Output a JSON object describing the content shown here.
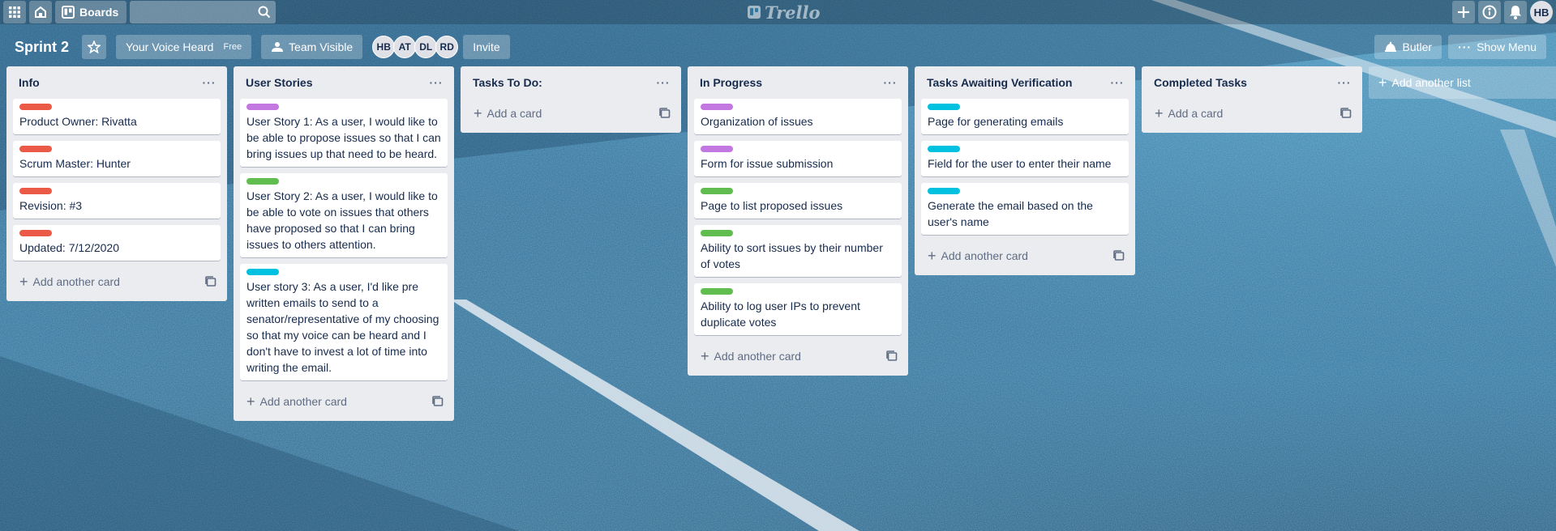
{
  "header": {
    "apps_icon": "grid-icon",
    "home_icon": "home-icon",
    "boards_label": "Boards",
    "search_value": "",
    "logo_text": "Trello",
    "user_initials": "HB"
  },
  "board": {
    "title": "Sprint 2",
    "workspace_label": "Your Voice Heard",
    "workspace_badge": "Free",
    "visibility_label": "Team Visible",
    "members": [
      "HB",
      "AT",
      "DL",
      "RD"
    ],
    "invite_label": "Invite",
    "butler_label": "Butler",
    "show_menu_label": "Show Menu"
  },
  "colors": {
    "red": "#eb5a46",
    "purple": "#c377e0",
    "green": "#61bd4f",
    "sky": "#00c2e0"
  },
  "lists": [
    {
      "title": "Info",
      "cards": [
        {
          "label": "red",
          "text": "Product Owner: Rivatta"
        },
        {
          "label": "red",
          "text": "Scrum Master: Hunter"
        },
        {
          "label": "red",
          "text": "Revision: #3"
        },
        {
          "label": "red",
          "text": "Updated: 7/12/2020"
        }
      ],
      "add_label": "Add another card"
    },
    {
      "title": "User Stories",
      "cards": [
        {
          "label": "purple",
          "text": "User Story 1: As a user, I would like to be able to propose issues so that I can bring issues up that need to be heard."
        },
        {
          "label": "green",
          "text": "User Story 2: As a user, I would like to be able to vote on issues that others have proposed so that I can bring issues to others attention."
        },
        {
          "label": "sky",
          "text": "User story 3: As a user, I'd like pre written emails to send to a senator/representative of my choosing so that my voice can be heard and I don't have to invest a lot of time into writing the email."
        }
      ],
      "add_label": "Add another card"
    },
    {
      "title": "Tasks To Do:",
      "cards": [],
      "add_label": "Add a card"
    },
    {
      "title": "In Progress",
      "cards": [
        {
          "label": "purple",
          "text": "Organization of issues"
        },
        {
          "label": "purple",
          "text": "Form for issue submission"
        },
        {
          "label": "green",
          "text": "Page to list proposed issues"
        },
        {
          "label": "green",
          "text": "Ability to sort issues by their number of votes"
        },
        {
          "label": "green",
          "text": "Ability to log user IPs to prevent duplicate votes"
        }
      ],
      "add_label": "Add another card"
    },
    {
      "title": "Tasks Awaiting Verification",
      "cards": [
        {
          "label": "sky",
          "text": "Page for generating emails"
        },
        {
          "label": "sky",
          "text": "Field for the user to enter their name"
        },
        {
          "label": "sky",
          "text": "Generate the email based on the user's name"
        }
      ],
      "add_label": "Add another card"
    },
    {
      "title": "Completed Tasks",
      "cards": [],
      "add_label": "Add a card"
    }
  ],
  "add_list_label": "Add another list"
}
